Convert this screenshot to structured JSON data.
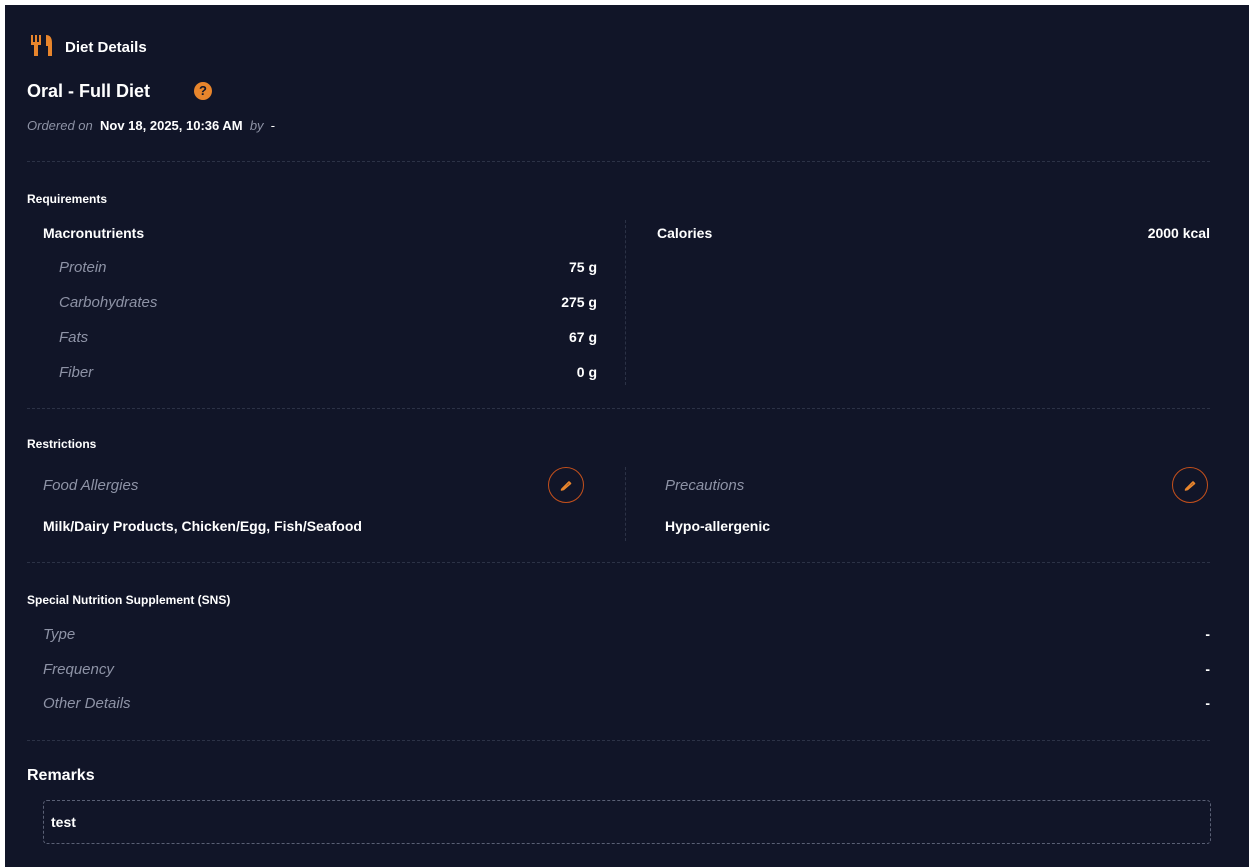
{
  "header": {
    "title": "Diet Details",
    "icon": "fork-knife-icon"
  },
  "diet": {
    "name": "Oral - Full Diet",
    "ordered_prefix": "Ordered on",
    "ordered_date": "Nov 18, 2025, 10:36 AM",
    "ordered_by_label": "by",
    "ordered_by": "-"
  },
  "requirements": {
    "title": "Requirements",
    "macros_title": "Macronutrients",
    "macros": [
      {
        "label": "Protein",
        "value": "75 g"
      },
      {
        "label": "Carbohydrates",
        "value": "275 g"
      },
      {
        "label": "Fats",
        "value": "67 g"
      },
      {
        "label": "Fiber",
        "value": "0 g"
      }
    ],
    "calories_label": "Calories",
    "calories_value": "2000 kcal"
  },
  "restrictions": {
    "title": "Restrictions",
    "allergies_label": "Food Allergies",
    "allergies_value": "Milk/Dairy Products, Chicken/Egg, Fish/Seafood",
    "precautions_label": "Precautions",
    "precautions_value": "Hypo-allergenic"
  },
  "sns": {
    "title": "Special Nutrition Supplement (SNS)",
    "rows": [
      {
        "label": "Type",
        "value": "-"
      },
      {
        "label": "Frequency",
        "value": "-"
      },
      {
        "label": "Other Details",
        "value": "-"
      }
    ]
  },
  "remarks": {
    "title": "Remarks",
    "value": "test"
  },
  "colors": {
    "background": "#111528",
    "accent": "#e8852c",
    "muted": "#8e93a6",
    "edit_border": "#c4501c"
  }
}
